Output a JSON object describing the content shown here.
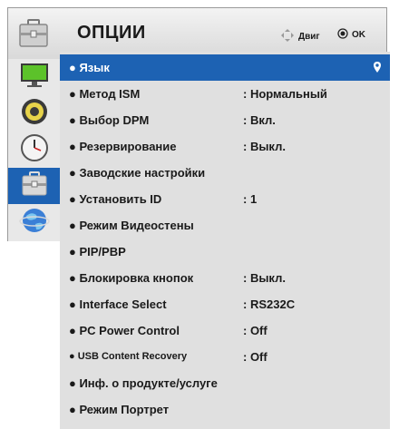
{
  "header": {
    "title": "ОПЦИИ",
    "move_hint": "Двиг",
    "ok_hint": "OK"
  },
  "sidebar": {
    "items": [
      {
        "icon": "monitor-icon",
        "active": false
      },
      {
        "icon": "speaker-icon",
        "active": false
      },
      {
        "icon": "clock-icon",
        "active": false
      },
      {
        "icon": "toolbox-icon",
        "active": true
      },
      {
        "icon": "globe-icon",
        "active": false
      }
    ]
  },
  "menu": {
    "rows": [
      {
        "label": "● Язык",
        "value": "",
        "selected": true
      },
      {
        "label": "● Метод ISM",
        "value": ": Нормальный"
      },
      {
        "label": "● Выбор DPM",
        "value": ": Вкл."
      },
      {
        "label": "● Резервирование",
        "value": ": Выкл."
      },
      {
        "label": "● Заводские настройки",
        "value": ""
      },
      {
        "label": "● Установить ID",
        "value": ": 1"
      },
      {
        "label": "● Режим Видеостены",
        "value": ""
      },
      {
        "label": "● PIP/PBP",
        "value": ""
      },
      {
        "label": "● Блокировка кнопок",
        "value": ": Выкл."
      },
      {
        "label": "● Interface Select",
        "value": ": RS232C"
      },
      {
        "label": "● PC Power Control",
        "value": ": Off"
      },
      {
        "label": "● USB Content Recovery",
        "value": ": Off"
      },
      {
        "label": "● Инф. о продукте/услуге",
        "value": ""
      },
      {
        "label": "● Режим Портрет",
        "value": ""
      }
    ]
  },
  "colors": {
    "accent": "#1d62b3",
    "panel": "#e0e0e0",
    "header": "#e6e6e6"
  }
}
